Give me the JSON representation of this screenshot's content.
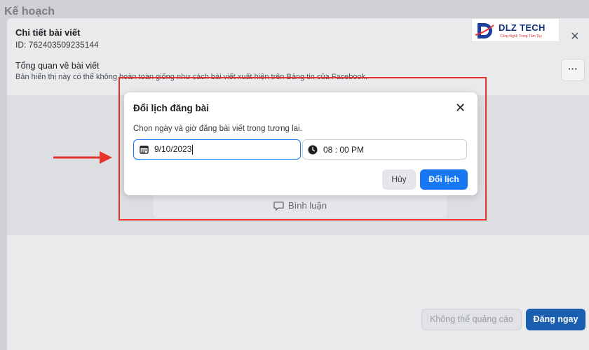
{
  "background": {
    "page_title": "Kế hoạch"
  },
  "post_details": {
    "title": "Chi tiết bài viết",
    "id_text": "ID: 762403509235144",
    "close_glyph": "×",
    "overview_title": "Tổng quan về bài viết",
    "overview_desc": "Bản hiển thị này có thể không hoàn toàn giống như cách bài viết xuất hiện trên Bảng tin của Facebook.",
    "more_glyph": "···",
    "comment_label": "Bình luận",
    "no_ad_label": "Không thể quảng cáo",
    "post_now_label": "Đăng ngay"
  },
  "reschedule_dialog": {
    "title": "Đổi lịch đăng bài",
    "close_glyph": "✕",
    "description": "Chọn ngày và giờ đăng bài viết trong tương lai.",
    "date_value": "9/10/2023",
    "time_value": "08 : 00 PM",
    "cancel_label": "Hủy",
    "confirm_label": "Đổi lịch"
  },
  "watermark": {
    "brand": "DLZ TECH",
    "tagline": "Công Nghệ Trong Tầm Tay"
  },
  "icons": {
    "calendar": "calendar-icon",
    "clock": "clock-icon",
    "comment": "comment-icon",
    "close": "close-icon",
    "more": "more-icon"
  },
  "colors": {
    "primary": "#1877f2",
    "primary_dim": "#1b5fb0",
    "annotation": "#e6342d"
  }
}
